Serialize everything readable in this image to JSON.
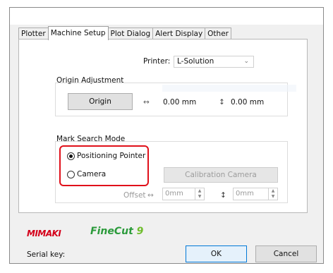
{
  "tabs": [
    {
      "label": "Plotter",
      "active": false
    },
    {
      "label": "Machine Setup",
      "active": true
    },
    {
      "label": "Plot Dialog",
      "active": false
    },
    {
      "label": "Alert Display",
      "active": false
    },
    {
      "label": "Other",
      "active": false
    }
  ],
  "printer": {
    "label": "Printer:",
    "value": "L-Solution"
  },
  "origin_adjustment": {
    "group_label": "Origin Adjustment",
    "origin_button": "Origin",
    "x_symbol": "↔",
    "x_value": "0.00 mm",
    "y_symbol": "↕",
    "y_value": "0.00 mm"
  },
  "mark_search_mode": {
    "group_label": "Mark Search Mode",
    "options": [
      {
        "label": "Positioning Pointer",
        "selected": true
      },
      {
        "label": "Camera",
        "selected": false
      }
    ],
    "calibration_button": "Calibration Camera",
    "offset_label": "Offset",
    "offset_x_symbol": "↔",
    "offset_x_value": "0mm",
    "offset_y_symbol": "↕",
    "offset_y_value": "0mm"
  },
  "brand": {
    "mimaki": "MIMAKI",
    "product": "FineCut",
    "version": "9"
  },
  "serial_key_label": "Serial key:",
  "buttons": {
    "ok": "OK",
    "cancel": "Cancel"
  },
  "colors": {
    "highlight": "#e0101a",
    "mimaki_red": "#d4001a",
    "finecut_green": "#2a9a3a",
    "primary_border": "#0078d7"
  },
  "icons": {
    "dropdown": "chevron-down-icon",
    "spin": "spin-updown-icon"
  }
}
